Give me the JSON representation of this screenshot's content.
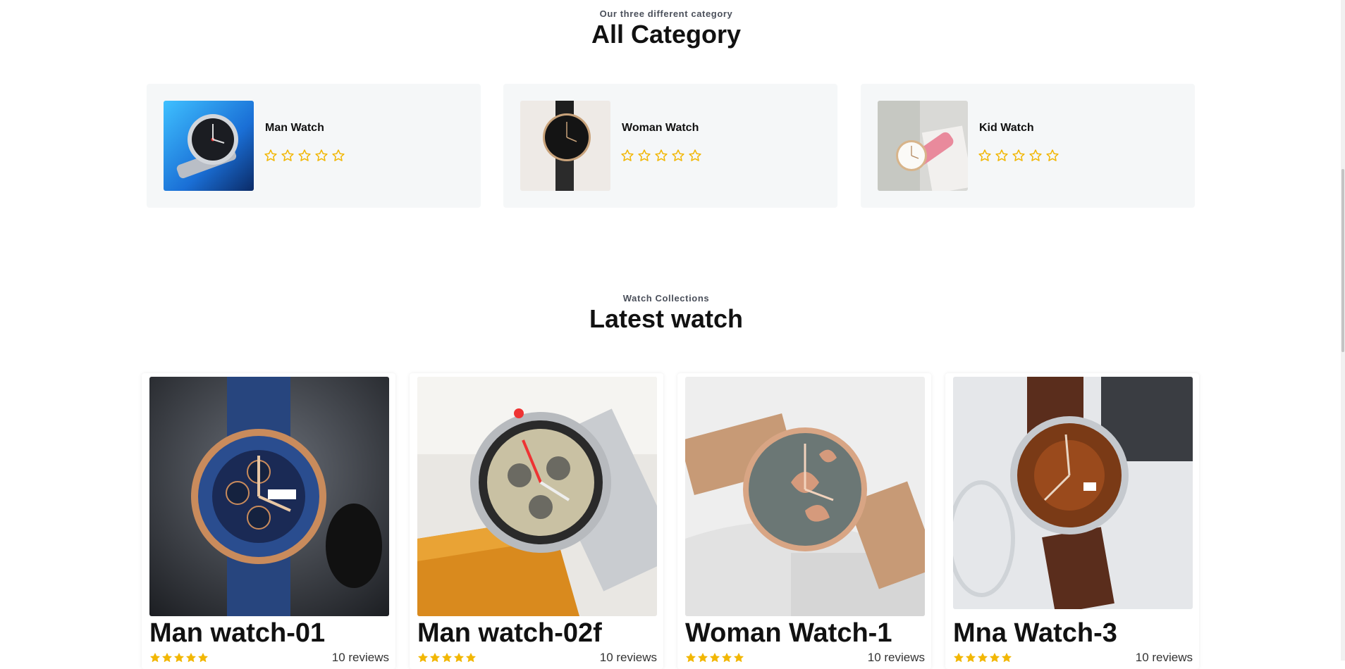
{
  "category_section": {
    "eyebrow": "Our three different category",
    "title": "All Category",
    "items": [
      {
        "name": "Man Watch",
        "rating": 0
      },
      {
        "name": "Woman Watch",
        "rating": 0
      },
      {
        "name": "Kid Watch",
        "rating": 0
      }
    ]
  },
  "latest_section": {
    "eyebrow": "Watch Collections",
    "title": "Latest watch",
    "products": [
      {
        "name": "Man watch-01",
        "reviews": "10 reviews",
        "rating": 5
      },
      {
        "name": "Man watch-02f",
        "reviews": "10 reviews",
        "rating": 5
      },
      {
        "name": "Woman Watch-1",
        "reviews": "10 reviews",
        "rating": 5
      },
      {
        "name": "Mna Watch-3",
        "reviews": "10 reviews",
        "rating": 5
      }
    ]
  },
  "colors": {
    "star": "#f2b705",
    "card_bg": "#f5f7f8"
  },
  "icons": {
    "star_outline": "star-outline-icon",
    "star_filled": "star-filled-icon"
  }
}
